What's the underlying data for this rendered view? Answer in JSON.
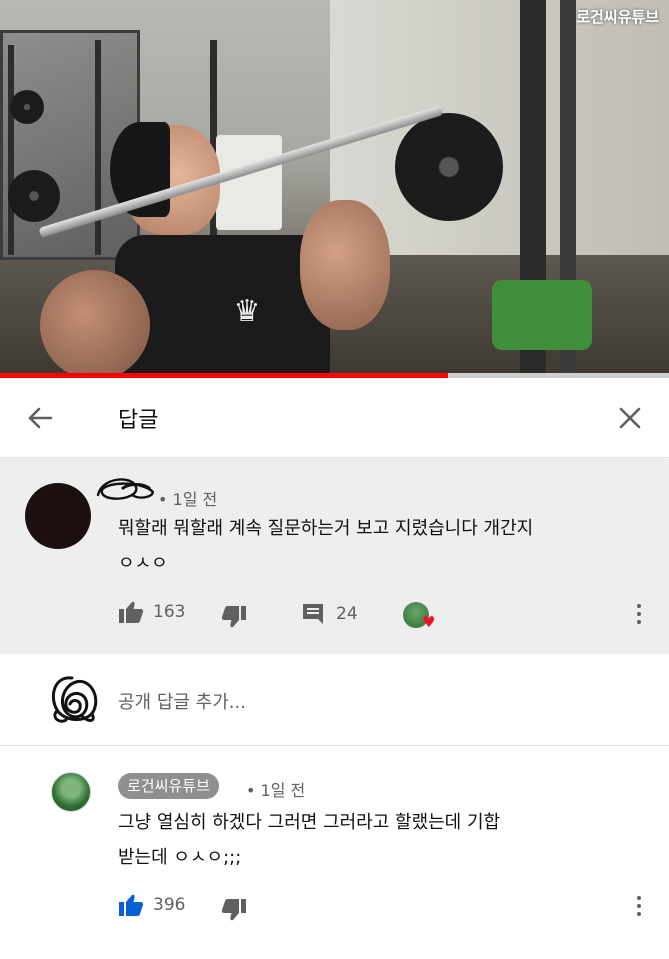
{
  "video": {
    "watermark": "로건씨유튜브",
    "progress_fraction": 0.67,
    "progress_color": "#ff0000"
  },
  "header": {
    "back_icon": "arrow-left-icon",
    "title": "답글",
    "close_icon": "close-icon"
  },
  "parent_comment": {
    "age": "• 1일 전",
    "text_line1": "뭐할래 뭐할래 계속 질문하는거 보고 지렸습니다 개간지",
    "text_line2": "ㅇㅅㅇ",
    "likes": "163",
    "replies": "24",
    "like_icon": "thumbs-up-icon",
    "dislike_icon": "thumbs-down-icon",
    "reply_icon": "comment-icon",
    "creator_heart": "♥"
  },
  "add_reply": {
    "placeholder": "공개 답글 추가..."
  },
  "reply": {
    "author": "로건씨유튜브",
    "age": "• 1일 전",
    "text_line1": "그냥 열심히 하겠다 그러면 그러라고 할랬는데 기합",
    "text_line2": "받는데 ㅇㅅㅇ;;;",
    "likes": "396",
    "like_color": "#065fd4"
  }
}
